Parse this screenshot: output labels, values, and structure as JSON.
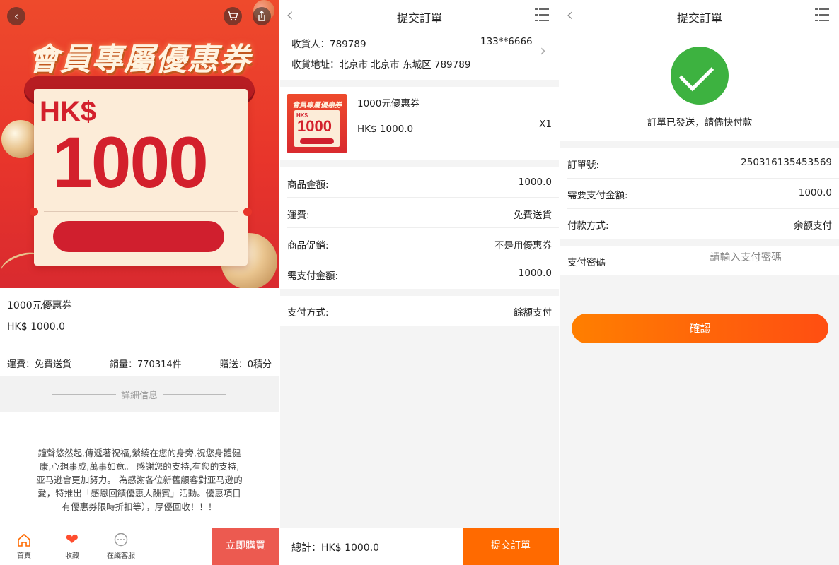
{
  "product_page": {
    "banner": {
      "title": "會員專屬優惠券",
      "currency": "HK$",
      "amount": "1000",
      "back_icon": "chevron-left-icon",
      "cart_icon": "cart-icon",
      "share_icon": "share-icon"
    },
    "product_name": "1000元優惠券",
    "price": "HK$ 1000.0",
    "shipping": "運費：免費送貨",
    "sales": "銷量：770314件",
    "points": "贈送：0積分",
    "detail_title": "詳細信息",
    "description": "鐘聲悠然起,傳遞著祝福,縈繞在您的身旁,祝您身體健康,心想事成,萬事如意。 感謝您的支持,有您的支持,亚马逊會更加努力。 為感謝各位新舊顧客對亚马逊的愛，特推出「感恩回饋優惠大酬賓」活動。優惠項目有優惠券限時折扣等），厚優回收！！！",
    "tabs": [
      {
        "label": "首頁",
        "icon": "home-icon"
      },
      {
        "label": "收藏",
        "icon": "heart-icon"
      },
      {
        "label": "在綫客服",
        "icon": "chat-icon"
      }
    ],
    "buy_button": "立即購買",
    "colors": {
      "banner": "#e8352b",
      "coupon_text": "#d3202c",
      "buy_button": "#ec5a50",
      "heart": "#ff4d2e"
    }
  },
  "submit_order_page": {
    "title": "提交訂單",
    "receiver_label": "收貨人：789789",
    "receiver_phone": "133**6666",
    "address_label": "收貨地址：北京市 北京市 东城区 789789",
    "item": {
      "name": "1000元優惠券",
      "price": "HK$ 1000.0",
      "qty": "X1",
      "thumb_title": "會員專屬優惠券",
      "thumb_currency": "HK$",
      "thumb_amount": "1000"
    },
    "rows": [
      {
        "label": "商品金額:",
        "value": "1000.0"
      },
      {
        "label": "運費:",
        "value": "免費送貨"
      },
      {
        "label": "商品促銷:",
        "value": "不是用優惠券"
      },
      {
        "label": "需支付金額:",
        "value": "1000.0"
      }
    ],
    "payment_label": "支付方式:",
    "payment_value": "餘額支付",
    "total": "總計：HK$ 1000.0",
    "submit_button": "提交訂單",
    "colors": {
      "submit_button": "#ff6a00"
    }
  },
  "order_sent_page": {
    "title": "提交訂單",
    "success_icon": "checkmark-icon",
    "message": "訂單已發送，請儘快付款",
    "rows": [
      {
        "label": "訂單號:",
        "value": "250316135453569"
      },
      {
        "label": "需要支付金額:",
        "value": "1000.0"
      },
      {
        "label": "付款方式:",
        "value": "余额支付"
      }
    ],
    "password_label": "支付密碼",
    "password_placeholder": "請輸入支付密碼",
    "confirm_button": "確認",
    "colors": {
      "success": "#3db240",
      "confirm_start": "#ff7f00",
      "confirm_end": "#ff4e12"
    }
  }
}
